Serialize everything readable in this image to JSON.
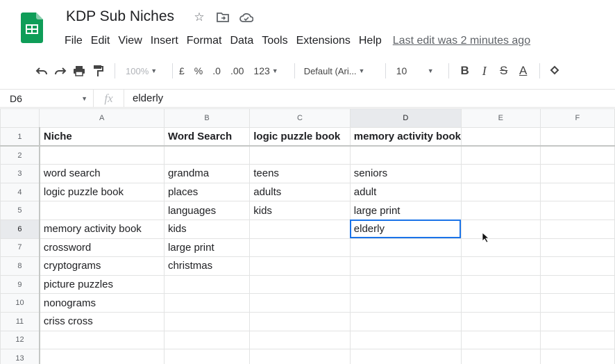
{
  "document": {
    "title": "KDP Sub Niches"
  },
  "menu": {
    "items": [
      "File",
      "Edit",
      "View",
      "Insert",
      "Format",
      "Data",
      "Tools",
      "Extensions",
      "Help"
    ],
    "last_edit": "Last edit was 2 minutes ago"
  },
  "toolbar": {
    "zoom": "100%",
    "currency": "£",
    "percent": "%",
    "decrease_decimal": ".0",
    "increase_decimal": ".00",
    "more_formats": "123",
    "font": "Default (Ari...",
    "font_size": "10",
    "bold": "B",
    "italic": "I",
    "strike": "S",
    "text_color": "A"
  },
  "formula_bar": {
    "cell_ref": "D6",
    "fx": "fx",
    "value": "elderly"
  },
  "grid": {
    "columns": [
      "A",
      "B",
      "C",
      "D",
      "E",
      "F"
    ],
    "selected_column": "D",
    "selected_row": "6",
    "active_cell": "D6",
    "rows": [
      {
        "num": "1",
        "cells": [
          "Niche",
          "Word Search",
          "logic puzzle book",
          "memory activity book",
          "",
          ""
        ]
      },
      {
        "num": "2",
        "cells": [
          "",
          "",
          "",
          "",
          "",
          ""
        ]
      },
      {
        "num": "3",
        "cells": [
          "word search",
          "grandma",
          "teens",
          "seniors",
          "",
          ""
        ]
      },
      {
        "num": "4",
        "cells": [
          "logic puzzle book",
          "places",
          "adults",
          "adult",
          "",
          ""
        ]
      },
      {
        "num": "5",
        "cells": [
          "",
          "languages",
          "kids",
          "large print",
          "",
          ""
        ]
      },
      {
        "num": "6",
        "cells": [
          "memory activity book",
          "kids",
          "",
          "elderly",
          "",
          ""
        ]
      },
      {
        "num": "7",
        "cells": [
          "crossword",
          "large print",
          "",
          "",
          "",
          ""
        ]
      },
      {
        "num": "8",
        "cells": [
          "cryptograms",
          "christmas",
          "",
          "",
          "",
          ""
        ]
      },
      {
        "num": "9",
        "cells": [
          "picture puzzles",
          "",
          "",
          "",
          "",
          ""
        ]
      },
      {
        "num": "10",
        "cells": [
          "nonograms",
          "",
          "",
          "",
          "",
          ""
        ]
      },
      {
        "num": "11",
        "cells": [
          "criss cross",
          "",
          "",
          "",
          "",
          ""
        ]
      },
      {
        "num": "12",
        "cells": [
          "",
          "",
          "",
          "",
          "",
          ""
        ]
      },
      {
        "num": "13",
        "cells": [
          "",
          "",
          "",
          "",
          "",
          ""
        ]
      }
    ]
  },
  "colors": {
    "sheets_green": "#0f9d58",
    "selection_blue": "#1a73e8",
    "header_bg": "#f8f9fa"
  }
}
